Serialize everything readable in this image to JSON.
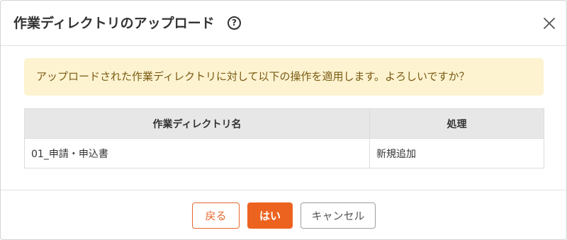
{
  "dialog": {
    "title": "作業ディレクトリのアップロード",
    "help_icon": "question-circle-icon",
    "help_glyph": "?",
    "close_icon": "close-icon"
  },
  "alert": {
    "message": "アップロードされた作業ディレクトリに対して以下の操作を適用します。よろしいですか？",
    "color": "#fdf3d1"
  },
  "table": {
    "headers": [
      "作業ディレクトリ名",
      "処理"
    ],
    "rows": [
      [
        "01_申請・申込書",
        "新規追加"
      ]
    ]
  },
  "footer": {
    "back_label": "戻る",
    "yes_label": "はい",
    "cancel_label": "キャンセル"
  },
  "colors": {
    "accent": "#ec6320"
  }
}
